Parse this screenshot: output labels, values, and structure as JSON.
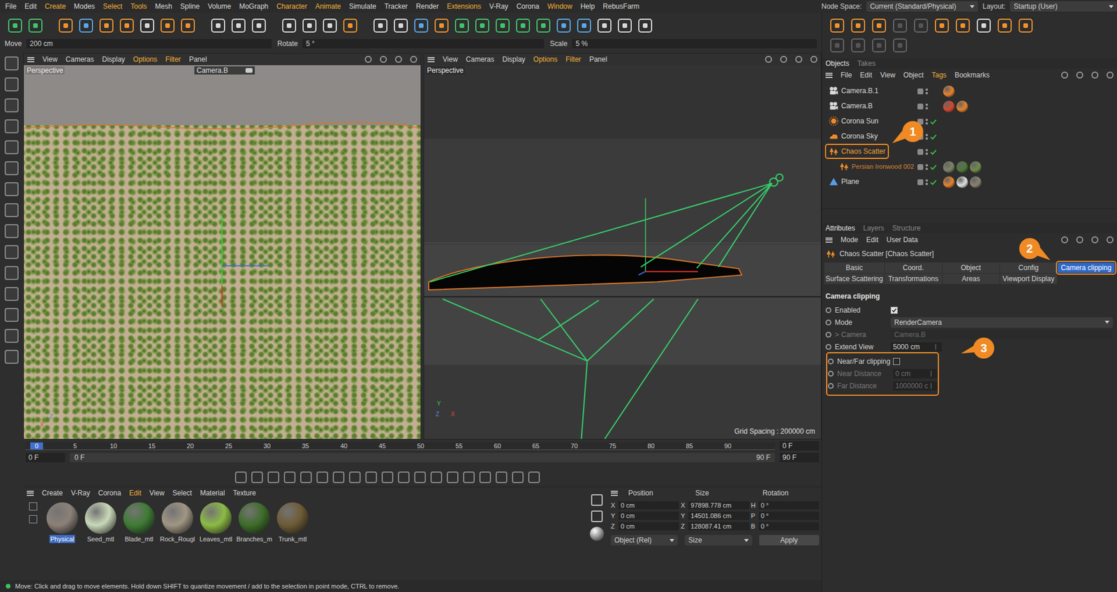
{
  "menu": [
    {
      "label": "File",
      "highlight": false
    },
    {
      "label": "Edit",
      "highlight": false
    },
    {
      "label": "Create",
      "highlight": true
    },
    {
      "label": "Modes",
      "highlight": false
    },
    {
      "label": "Select",
      "highlight": true
    },
    {
      "label": "Tools",
      "highlight": true
    },
    {
      "label": "Mesh",
      "highlight": false
    },
    {
      "label": "Spline",
      "highlight": false
    },
    {
      "label": "Volume",
      "highlight": false
    },
    {
      "label": "MoGraph",
      "highlight": false
    },
    {
      "label": "Character",
      "highlight": true
    },
    {
      "label": "Animate",
      "highlight": true
    },
    {
      "label": "Simulate",
      "highlight": false
    },
    {
      "label": "Tracker",
      "highlight": false
    },
    {
      "label": "Render",
      "highlight": false
    },
    {
      "label": "Extensions",
      "highlight": true
    },
    {
      "label": "V-Ray",
      "highlight": false
    },
    {
      "label": "Corona",
      "highlight": false
    },
    {
      "label": "Window",
      "highlight": true
    },
    {
      "label": "Help",
      "highlight": false
    },
    {
      "label": "RebusFarm",
      "highlight": false
    }
  ],
  "nodeSpace": {
    "label": "Node Space:",
    "value": "Current (Standard/Physical)"
  },
  "layout": {
    "label": "Layout:",
    "value": "Startup (User)"
  },
  "coordBar": [
    {
      "label": "Move",
      "value": "200 cm"
    },
    {
      "label": "Rotate",
      "value": "5 °"
    },
    {
      "label": "Scale",
      "value": "5 %"
    }
  ],
  "leftViewport": {
    "menu": [
      {
        "label": "View",
        "highlight": false
      },
      {
        "label": "Cameras",
        "highlight": false
      },
      {
        "label": "Display",
        "highlight": false
      },
      {
        "label": "Options",
        "highlight": true
      },
      {
        "label": "Filter",
        "highlight": true
      },
      {
        "label": "Panel",
        "highlight": false
      }
    ],
    "title": "Perspective",
    "camera": "Camera.B",
    "axes": [
      "Z",
      "X"
    ]
  },
  "rightViewport": {
    "menu": [
      {
        "label": "View",
        "highlight": false
      },
      {
        "label": "Cameras",
        "highlight": false
      },
      {
        "label": "Display",
        "highlight": false
      },
      {
        "label": "Options",
        "highlight": true
      },
      {
        "label": "Filter",
        "highlight": true
      },
      {
        "label": "Panel",
        "highlight": false
      }
    ],
    "title": "Perspective",
    "axes": [
      "Y",
      "Z",
      "X"
    ],
    "grid": "Grid Spacing : 200000 cm"
  },
  "timeline": {
    "ticks": [
      {
        "label": "0",
        "selected": true
      },
      {
        "label": "5",
        "selected": false
      },
      {
        "label": "10",
        "selected": false
      },
      {
        "label": "15",
        "selected": false
      },
      {
        "label": "20",
        "selected": false
      },
      {
        "label": "25",
        "selected": false
      },
      {
        "label": "30",
        "selected": false
      },
      {
        "label": "35",
        "selected": false
      },
      {
        "label": "40",
        "selected": false
      },
      {
        "label": "45",
        "selected": false
      },
      {
        "label": "50",
        "selected": false
      },
      {
        "label": "55",
        "selected": false
      },
      {
        "label": "60",
        "selected": false
      },
      {
        "label": "65",
        "selected": false
      },
      {
        "label": "70",
        "selected": false
      },
      {
        "label": "75",
        "selected": false
      },
      {
        "label": "80",
        "selected": false
      },
      {
        "label": "85",
        "selected": false
      },
      {
        "label": "90",
        "selected": false
      }
    ],
    "currentField": "0 F",
    "startField": "0 F",
    "rangeStart": "0 F",
    "rangeEnd": "90 F",
    "endField": "90 F"
  },
  "materials": {
    "menu": [
      {
        "label": "Create",
        "highlight": false
      },
      {
        "label": "V-Ray",
        "highlight": false
      },
      {
        "label": "Corona",
        "highlight": false
      },
      {
        "label": "Edit",
        "highlight": true
      },
      {
        "label": "View",
        "highlight": false
      },
      {
        "label": "Select",
        "highlight": false
      },
      {
        "label": "Material",
        "highlight": false
      },
      {
        "label": "Texture",
        "highlight": false
      }
    ],
    "items": [
      {
        "name": "Physical",
        "selected": true,
        "color": "#8c8178"
      },
      {
        "name": "Seed_mtl",
        "selected": false,
        "color": "#c9d8b9"
      },
      {
        "name": "Blade_mtl",
        "selected": false,
        "color": "#3f7c35"
      },
      {
        "name": "Rock_Rougl",
        "selected": false,
        "color": "#a09683"
      },
      {
        "name": "Leaves_mtl",
        "selected": false,
        "color": "#8dbb45"
      },
      {
        "name": "Branches_m",
        "selected": false,
        "color": "#3e6d2a"
      },
      {
        "name": "Trunk_mtl",
        "selected": false,
        "color": "#6e5b36"
      }
    ]
  },
  "coordManager": {
    "headers": [
      "Position",
      "Size",
      "Rotation"
    ],
    "rows": [
      {
        "pLabel": "X",
        "p": "0 cm",
        "sLabel": "X",
        "s": "97898.778 cm",
        "rLabel": "H",
        "r": "0 °"
      },
      {
        "pLabel": "Y",
        "p": "0 cm",
        "sLabel": "Y",
        "s": "14501.086 cm",
        "rLabel": "P",
        "r": "0 °"
      },
      {
        "pLabel": "Z",
        "p": "0 cm",
        "sLabel": "Z",
        "s": "128087.41 cm",
        "rLabel": "B",
        "r": "0 °"
      }
    ],
    "modes": [
      "Object (Rel)",
      "Size"
    ],
    "apply": "Apply"
  },
  "objectsTabs": [
    {
      "label": "Objects",
      "selected": true
    },
    {
      "label": "Takes",
      "selected": false
    }
  ],
  "objectsMenu": [
    {
      "label": "File",
      "highlight": false
    },
    {
      "label": "Edit",
      "highlight": false
    },
    {
      "label": "View",
      "highlight": false
    },
    {
      "label": "Object",
      "highlight": false
    },
    {
      "label": "Tags",
      "highlight": true
    },
    {
      "label": "Bookmarks",
      "highlight": false
    }
  ],
  "objects": [
    {
      "name": "Camera.B.1",
      "kind": "camera",
      "indent": false,
      "selected": false,
      "childOfSelected": false,
      "enabled": false,
      "callout": "",
      "tags": [
        "#e8822a"
      ]
    },
    {
      "name": "Camera.B",
      "kind": "camera",
      "indent": false,
      "selected": false,
      "childOfSelected": false,
      "enabled": false,
      "callout": "",
      "tags": [
        "#d9462e",
        "#e8822a"
      ]
    },
    {
      "name": "Corona Sun",
      "kind": "sun",
      "indent": false,
      "selected": false,
      "childOfSelected": false,
      "enabled": true,
      "callout": "",
      "tags": []
    },
    {
      "name": "Corona Sky",
      "kind": "sky",
      "indent": false,
      "selected": false,
      "childOfSelected": false,
      "enabled": true,
      "callout": "",
      "tags": []
    },
    {
      "name": "Chaos Scatter",
      "kind": "scatter",
      "indent": false,
      "selected": true,
      "childOfSelected": false,
      "enabled": true,
      "callout": "1",
      "tags": []
    },
    {
      "name": "Persian Ironwood 002",
      "kind": "scatter",
      "indent": true,
      "selected": false,
      "childOfSelected": true,
      "enabled": true,
      "callout": "",
      "tags": [
        "#7d8468",
        "#4c7a37",
        "#6f8c4a"
      ]
    },
    {
      "name": "Plane",
      "kind": "plane",
      "indent": false,
      "selected": false,
      "childOfSelected": false,
      "enabled": true,
      "callout": "",
      "tags": [
        "#e8822a",
        "#e0e0e0",
        "#8a8172"
      ]
    }
  ],
  "attributesTabs": [
    {
      "label": "Attributes",
      "selected": true
    },
    {
      "label": "Layers",
      "selected": false
    },
    {
      "label": "Structure",
      "selected": false
    }
  ],
  "attributesMenu": [
    "Mode",
    "Edit",
    "User Data"
  ],
  "attributesTitle": "Chaos Scatter [Chaos Scatter]",
  "attrTabs": [
    {
      "label": "Basic",
      "selected": false,
      "callout": ""
    },
    {
      "label": "Coord.",
      "selected": false,
      "callout": ""
    },
    {
      "label": "Object",
      "selected": false,
      "callout": ""
    },
    {
      "label": "Config",
      "selected": false,
      "callout": ""
    },
    {
      "label": "Camera clipping",
      "selected": true,
      "callout": "2"
    },
    {
      "label": "Surface Scattering",
      "selected": false,
      "callout": ""
    },
    {
      "label": "Transformations",
      "selected": false,
      "callout": ""
    },
    {
      "label": "Areas",
      "selected": false,
      "callout": ""
    },
    {
      "label": "Viewport Display",
      "selected": false,
      "callout": ""
    }
  ],
  "section": "Camera clipping",
  "fields": [
    {
      "label": "Enabled",
      "kind": "checkbox",
      "checked": true,
      "disabled": false,
      "value": "",
      "expander": ""
    },
    {
      "label": "Mode",
      "kind": "dropdown",
      "checked": false,
      "disabled": false,
      "value": "RenderCamera",
      "expander": ""
    },
    {
      "label": "Camera",
      "kind": "link",
      "checked": false,
      "disabled": true,
      "value": "Camera.B",
      "expander": ">"
    },
    {
      "label": "Extend View",
      "kind": "number",
      "checked": false,
      "disabled": false,
      "value": "5000 cm",
      "expander": ""
    }
  ],
  "clipGroup": {
    "callout": "3",
    "fields": [
      {
        "label": "Near/Far clipping",
        "kind": "checkbox",
        "checked": false,
        "disabled": false,
        "value": ""
      },
      {
        "label": "Near Distance",
        "kind": "number",
        "checked": false,
        "disabled": true,
        "value": "0 cm"
      },
      {
        "label": "Far Distance",
        "kind": "number",
        "checked": false,
        "disabled": true,
        "value": "1000000 c"
      }
    ]
  },
  "status": "Move: Click and drag to move elements. Hold down SHIFT to quantize movement / add to the selection in point mode, CTRL to remove."
}
